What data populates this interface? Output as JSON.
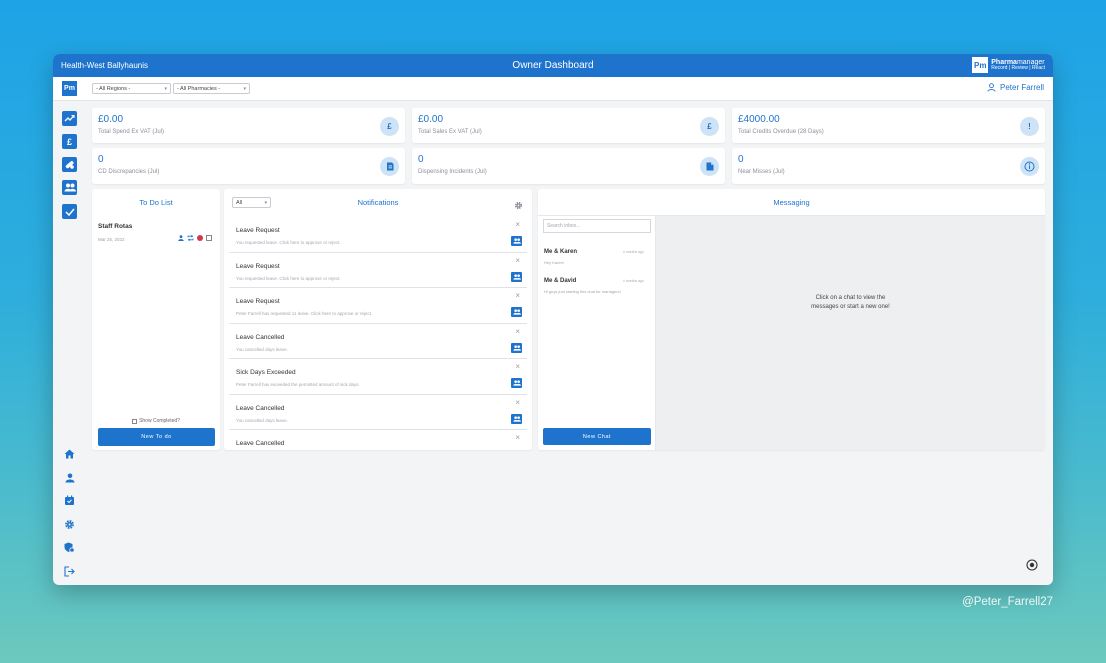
{
  "window": {
    "org_name": "Health-West Ballyhaunis",
    "title": "Owner Dashboard",
    "brand": {
      "logo_text": "Pm",
      "name_bold": "Pharma",
      "name_rest": "manager",
      "tagline": "Record | Review | React"
    }
  },
  "filters": {
    "logo_text": "Pm",
    "regions": "- All Regions -",
    "pharmacies": "- All Pharmacies -",
    "user_name": "Peter Farrell"
  },
  "sidebar": {
    "top": [
      {
        "name": "sales-trend",
        "icon": "trend-chart-icon"
      },
      {
        "name": "spend",
        "icon": "pound-icon"
      },
      {
        "name": "prescriptions",
        "icon": "pill-icon"
      },
      {
        "name": "staff",
        "icon": "group-icon"
      },
      {
        "name": "tasks",
        "icon": "checkmark-icon"
      }
    ],
    "bottom": [
      {
        "name": "home",
        "icon": "home-icon"
      },
      {
        "name": "profile",
        "icon": "user-icon"
      },
      {
        "name": "rota",
        "icon": "calendar-icon"
      },
      {
        "name": "settings",
        "icon": "gear-icon"
      },
      {
        "name": "admin",
        "icon": "shield-gear-icon"
      },
      {
        "name": "logout",
        "icon": "logout-icon"
      }
    ]
  },
  "stats": [
    {
      "value": "£0.00",
      "label": "Total Spend Ex VAT (Jul)",
      "icon": "£"
    },
    {
      "value": "£0.00",
      "label": "Total Sales Ex VAT (Jul)",
      "icon": "£"
    },
    {
      "value": "£4000.00",
      "label": "Total Credits Overdue (28 Days)",
      "icon": "!"
    },
    {
      "value": "0",
      "label": "CD Discrepancies (Jul)",
      "icon": "cd-icon"
    },
    {
      "value": "0",
      "label": "Dispensing Incidents (Jul)",
      "icon": "document-icon"
    },
    {
      "value": "0",
      "label": "Near Misses (Jul)",
      "icon": "i"
    }
  ],
  "todo": {
    "title": "To Do List",
    "item_title": "Staff Rotas",
    "item_date": "Mar 25, 2022",
    "show_completed": "Show Completed?",
    "new_button": "New To do"
  },
  "notifications": {
    "title": "Notifications",
    "filter_value": "All",
    "items": [
      {
        "title": "Leave Request",
        "desc": "You requested  leave. Click here to approve or reject."
      },
      {
        "title": "Leave Request",
        "desc": "You requested  leave. Click here to approve or reject."
      },
      {
        "title": "Leave Request",
        "desc": "Peter Farrell has requested 11 leave. Click here to approve or reject."
      },
      {
        "title": "Leave Cancelled",
        "desc": "You cancelled  days leave."
      },
      {
        "title": "Sick Days Exceeded",
        "desc": "Peter Farrell has exceeded the permitted amount of sick days."
      },
      {
        "title": "Leave Cancelled",
        "desc": "You cancelled  days leave."
      },
      {
        "title": "Leave Cancelled",
        "desc": ""
      }
    ]
  },
  "messaging": {
    "title": "Messaging",
    "search_placeholder": "Search inbox...",
    "chats": [
      {
        "name": "Me & Karen",
        "time": "4 months ago",
        "message": "Hey Karen!"
      },
      {
        "name": "Me & David",
        "time": "4 months ago",
        "message": "Hi guys just starting this chat for managers!"
      }
    ],
    "empty_text": "Click on a chat to view the messages or start a new one!",
    "new_chat_button": "New Chat"
  },
  "watermark": "@Peter_Farrell27",
  "colors": {
    "primary": "#1e74cc",
    "light_accent": "#cfe3f6",
    "status_red": "#d2384b"
  }
}
